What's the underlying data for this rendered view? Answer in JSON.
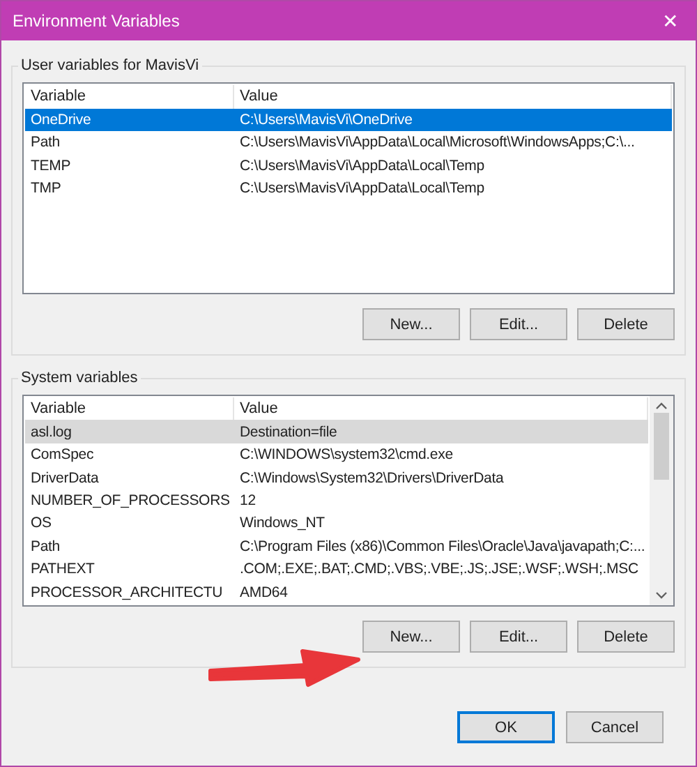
{
  "window": {
    "title": "Environment Variables",
    "close": "✕"
  },
  "user_group": {
    "title": "User variables for MavisVi",
    "active": true,
    "columns": [
      "Variable",
      "Value"
    ],
    "rows": [
      {
        "variable": "OneDrive",
        "value": "C:\\Users\\MavisVi\\OneDrive",
        "selected": true
      },
      {
        "variable": "Path",
        "value": "C:\\Users\\MavisVi\\AppData\\Local\\Microsoft\\WindowsApps;C:\\...",
        "selected": false
      },
      {
        "variable": "TEMP",
        "value": "C:\\Users\\MavisVi\\AppData\\Local\\Temp",
        "selected": false
      },
      {
        "variable": "TMP",
        "value": "C:\\Users\\MavisVi\\AppData\\Local\\Temp",
        "selected": false
      }
    ],
    "buttons": [
      "New...",
      "Edit...",
      "Delete"
    ]
  },
  "system_group": {
    "title": "System variables",
    "active": false,
    "columns": [
      "Variable",
      "Value"
    ],
    "rows": [
      {
        "variable": "asl.log",
        "value": "Destination=file",
        "selected": true
      },
      {
        "variable": "ComSpec",
        "value": "C:\\WINDOWS\\system32\\cmd.exe",
        "selected": false
      },
      {
        "variable": "DriverData",
        "value": "C:\\Windows\\System32\\Drivers\\DriverData",
        "selected": false
      },
      {
        "variable": "NUMBER_OF_PROCESSORS",
        "value": "12",
        "selected": false
      },
      {
        "variable": "OS",
        "value": "Windows_NT",
        "selected": false
      },
      {
        "variable": "Path",
        "value": "C:\\Program Files (x86)\\Common Files\\Oracle\\Java\\javapath;C:...",
        "selected": false
      },
      {
        "variable": "PATHEXT",
        "value": ".COM;.EXE;.BAT;.CMD;.VBS;.VBE;.JS;.JSE;.WSF;.WSH;.MSC",
        "selected": false
      },
      {
        "variable": "PROCESSOR_ARCHITECTU",
        "value": "AMD64",
        "selected": false
      }
    ],
    "buttons": [
      "New...",
      "Edit...",
      "Delete"
    ]
  },
  "dialog_buttons": [
    {
      "label": "OK",
      "default": true
    },
    {
      "label": "Cancel",
      "default": false
    }
  ]
}
